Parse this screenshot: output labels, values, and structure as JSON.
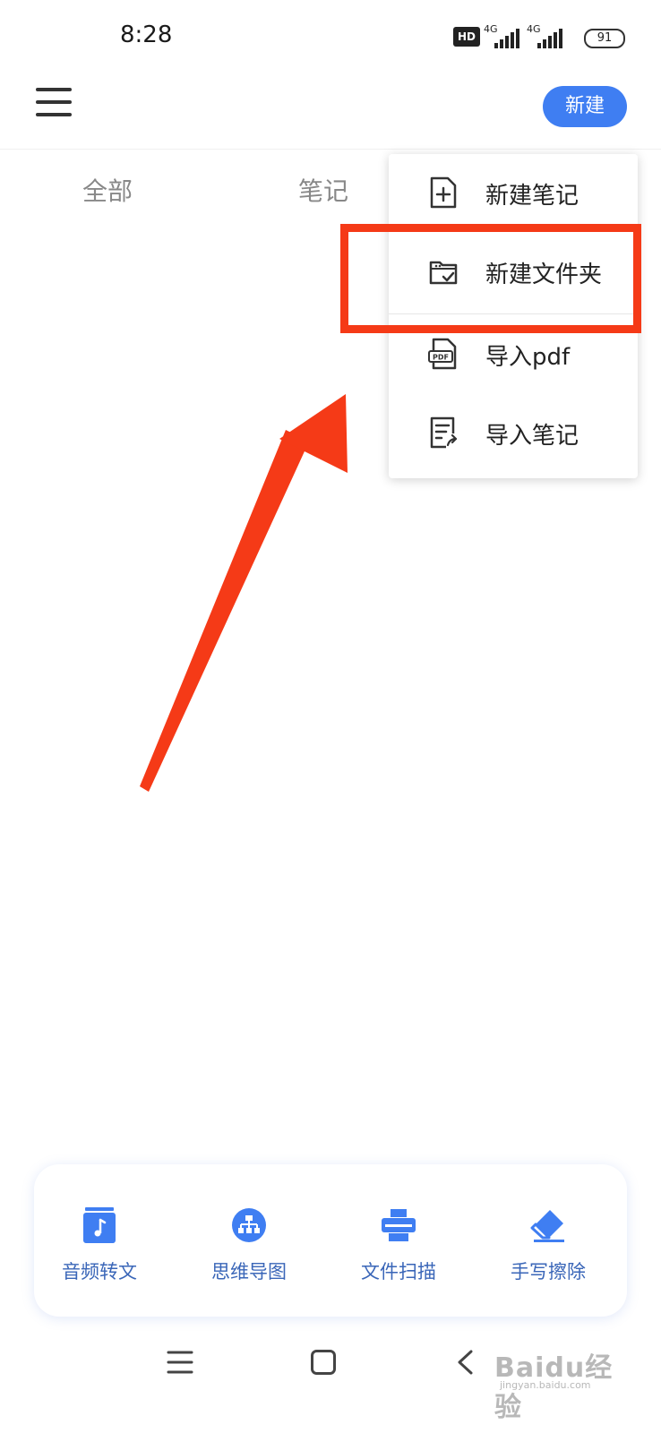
{
  "status_bar": {
    "time": "8:28",
    "hd": "HD",
    "net1": "4G",
    "net2": "4G",
    "battery": "91"
  },
  "header": {
    "new_button_label": "新建"
  },
  "tabs": [
    {
      "label": "全部"
    },
    {
      "label": "笔记"
    }
  ],
  "dropdown": {
    "items": [
      {
        "label": "新建笔记",
        "icon": "file-plus-icon"
      },
      {
        "label": "新建文件夹",
        "icon": "folder-check-icon"
      },
      {
        "label": "导入pdf",
        "icon": "pdf-file-icon"
      },
      {
        "label": "导入笔记",
        "icon": "import-note-icon"
      }
    ]
  },
  "annotation": {
    "highlight_color": "#f53a17"
  },
  "tools": [
    {
      "label": "音频转文",
      "icon": "audio-note-icon"
    },
    {
      "label": "思维导图",
      "icon": "mind-map-icon"
    },
    {
      "label": "文件扫描",
      "icon": "scanner-icon"
    },
    {
      "label": "手写擦除",
      "icon": "eraser-icon"
    }
  ],
  "accent_color": "#3f7ef2",
  "watermark": {
    "text": "Baidu经验",
    "url": "jingyan.baidu.com"
  }
}
